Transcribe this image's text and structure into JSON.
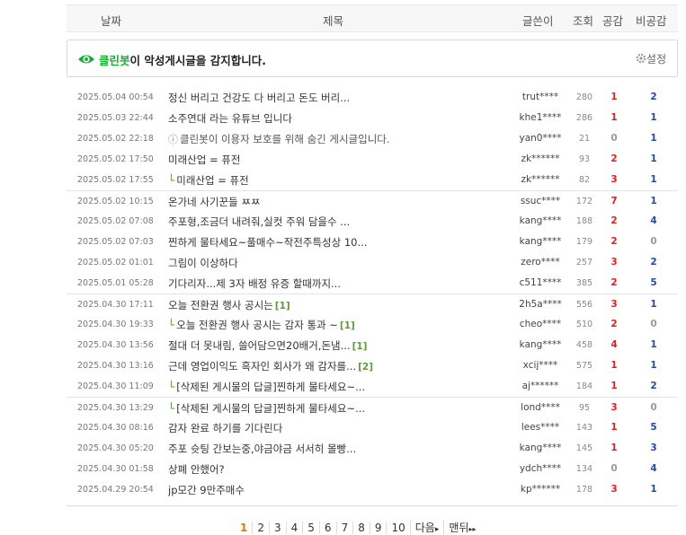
{
  "colors": {
    "brand": "#1aad36",
    "like": "#d9221b",
    "dislike": "#1f4ea3",
    "zero": "#999999",
    "accent": "#e8740c"
  },
  "header": {
    "date": "날짜",
    "title": "제목",
    "author": "글쓴이",
    "views": "조회",
    "likes": "공감",
    "dislikes": "비공감"
  },
  "cleanbot": {
    "brand": "클린봇",
    "message": "이 악성게시글을 감지합니다.",
    "settings_label": "설정"
  },
  "rows": [
    {
      "date": "2025.05.04 00:54",
      "title": "정신 버리고 건강도 다 버리고 돈도 버리...",
      "author": "trut****",
      "views": "280",
      "likes": "1",
      "dislikes": "2"
    },
    {
      "date": "2025.05.03 22:44",
      "title": "소주연대 라는 유튜브 입니다",
      "author": "khe1****",
      "views": "286",
      "likes": "1",
      "dislikes": "1"
    },
    {
      "date": "2025.05.02 22:18",
      "title": "클린봇이 이용자 보호를 위해 숨긴 게시글입니다.",
      "author": "yan0****",
      "views": "21",
      "likes": "0",
      "dislikes": "1",
      "hidden": true
    },
    {
      "date": "2025.05.02 17:50",
      "title": "미래산업 = 퓨전",
      "author": "zk******",
      "views": "93",
      "likes": "2",
      "dislikes": "1"
    },
    {
      "date": "2025.05.02 17:55",
      "title": "미래산업 = 퓨전",
      "author": "zk******",
      "views": "82",
      "likes": "3",
      "dislikes": "1",
      "reply": true
    },
    {
      "date": "2025.05.02 10:15",
      "title": "온가네 사기꾼들 ㅉㅉ",
      "author": "ssuc****",
      "views": "172",
      "likes": "7",
      "dislikes": "1",
      "sep": true
    },
    {
      "date": "2025.05.02 07:08",
      "title": "주포형,조금더 내려줘,실컷 주워 담을수 ...",
      "author": "kang****",
      "views": "188",
      "likes": "2",
      "dislikes": "4"
    },
    {
      "date": "2025.05.02 07:03",
      "title": "찐하게 물타세요~풀매수~작전주특성상 10...",
      "author": "kang****",
      "views": "179",
      "likes": "2",
      "dislikes": "0"
    },
    {
      "date": "2025.05.02 01:01",
      "title": "그림이 이상하다",
      "author": "zero****",
      "views": "257",
      "likes": "3",
      "dislikes": "2"
    },
    {
      "date": "2025.05.01 05:28",
      "title": "기다리자...제 3자 배정 유증 할때까지...",
      "author": "c511****",
      "views": "385",
      "likes": "2",
      "dislikes": "5"
    },
    {
      "date": "2025.04.30 17:11",
      "title": "오늘 전환권 행사 공시는",
      "comments": "[1]",
      "author": "2h5a****",
      "views": "556",
      "likes": "3",
      "dislikes": "1",
      "sep": true
    },
    {
      "date": "2025.04.30 19:33",
      "title": "오늘 전환권 행사 공시는 감자 통과 ~",
      "comments": "[1]",
      "author": "cheo****",
      "views": "510",
      "likes": "2",
      "dislikes": "0",
      "reply": true
    },
    {
      "date": "2025.04.30 13:56",
      "title": "절대 더 못내림, 쓸어담으면20배거,돈냄...",
      "comments": "[1]",
      "author": "kang****",
      "views": "458",
      "likes": "4",
      "dislikes": "1"
    },
    {
      "date": "2025.04.30 13:16",
      "title": "근데 영업이익도 흑자인 회사가 왜 감자를...",
      "comments": "[2]",
      "author": "xcij****",
      "views": "575",
      "likes": "1",
      "dislikes": "1"
    },
    {
      "date": "2025.04.30 11:09",
      "title": "[삭제된 게시물의 답글]찐하게 물타세요~...",
      "author": "aj******",
      "views": "184",
      "likes": "1",
      "dislikes": "2",
      "reply": true
    },
    {
      "date": "2025.04.30 13:29",
      "title": "[삭제된 게시물의 답글]찐하게 물타세요~...",
      "author": "lond****",
      "views": "95",
      "likes": "3",
      "dislikes": "0",
      "reply": true,
      "sep": true
    },
    {
      "date": "2025.04.30 08:16",
      "title": "감자 완료 하기를 기다린다",
      "author": "lees****",
      "views": "143",
      "likes": "1",
      "dislikes": "5"
    },
    {
      "date": "2025.04.30 05:20",
      "title": "주포 슛팅 간보는중,야금야금 서서히 몰빵...",
      "author": "kang****",
      "views": "145",
      "likes": "1",
      "dislikes": "3"
    },
    {
      "date": "2025.04.30 01:58",
      "title": "상폐 안했어?",
      "author": "ydch****",
      "views": "134",
      "likes": "0",
      "dislikes": "4"
    },
    {
      "date": "2025.04.29 20:54",
      "title": "jp모간 9만주매수",
      "author": "kp******",
      "views": "178",
      "likes": "3",
      "dislikes": "1"
    }
  ],
  "pagination": {
    "pages": [
      "1",
      "2",
      "3",
      "4",
      "5",
      "6",
      "7",
      "8",
      "9",
      "10"
    ],
    "current": "1",
    "next_label": "다음",
    "last_label": "맨뒤"
  }
}
